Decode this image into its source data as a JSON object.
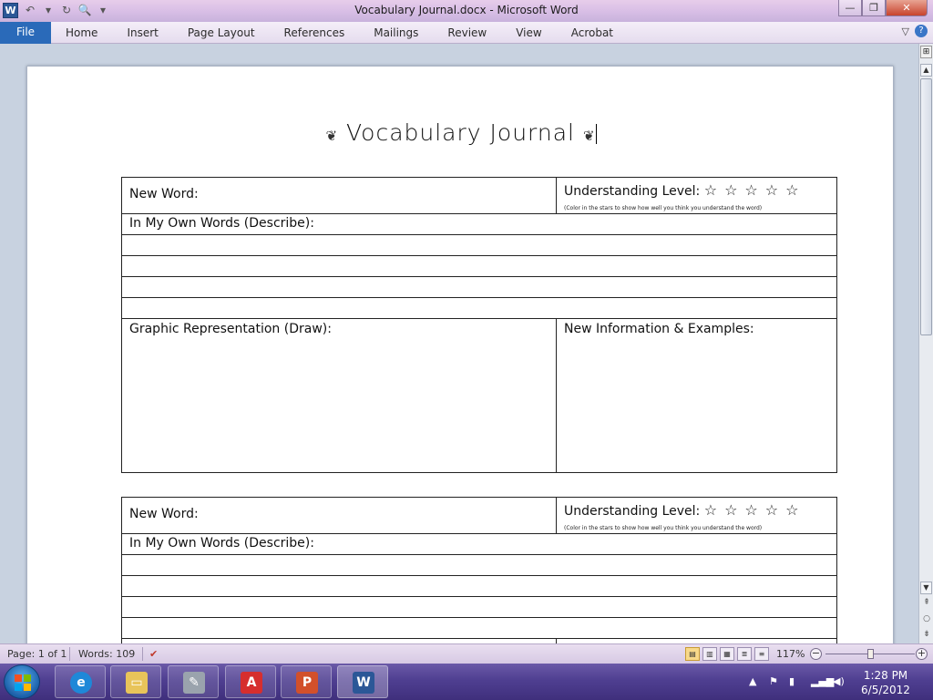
{
  "window": {
    "title": "Vocabulary Journal.docx - Microsoft Word",
    "app_icon": "W",
    "controls": {
      "minimize": "—",
      "restore": "❐",
      "close": "✕"
    }
  },
  "quick_access": {
    "undo": "↶",
    "undo_dd": "▾",
    "redo": "↻",
    "print_preview": "🔍",
    "customize": "▾"
  },
  "ribbon": {
    "file_label": "File",
    "tabs": [
      "Home",
      "Insert",
      "Page Layout",
      "References",
      "Mailings",
      "Review",
      "View",
      "Acrobat"
    ],
    "minimize_ribbon": "▽",
    "help": "?"
  },
  "document": {
    "title": "Vocabulary Journal",
    "bug_left": "❦",
    "bug_right": "❦",
    "block1": {
      "new_word_label": "New Word:",
      "understanding_label": "Understanding Level:",
      "stars": "☆☆☆☆☆",
      "understanding_note": "(Color in the stars to show how well you think you understand the word)",
      "own_words_label": "In My Own Words (Describe):",
      "graphic_label": "Graphic Representation (Draw):",
      "new_info_label": "New Information & Examples:"
    },
    "block2": {
      "new_word_label": "New Word:",
      "understanding_label": "Understanding Level:",
      "stars": "☆☆☆☆☆",
      "understanding_note": "(Color in the stars to show how well you think you understand the word)",
      "own_words_label": "In My Own Words (Describe):"
    }
  },
  "scrollbar": {
    "up": "▲",
    "down": "▼",
    "prev": "⇞",
    "browse": "○",
    "next": "⇟"
  },
  "status_bar": {
    "page": "Page: 1 of 1",
    "words": "Words: 109",
    "proofing_icon": "✔",
    "zoom": "117%",
    "zoom_out": "−",
    "zoom_in": "+",
    "zoom_fraction": 0.5
  },
  "taskbar": {
    "apps": [
      "internet-explorer",
      "windows-explorer",
      "paint-tools",
      "adobe-reader",
      "powerpoint",
      "word"
    ],
    "tray": {
      "show_hidden": "▲",
      "clock_time": "1:28 PM",
      "clock_date": "6/5/2012"
    }
  },
  "colors": {
    "file_tab": "#2a6ab9",
    "title_bar": "#d9bfe6",
    "taskbar": "#4f3f91"
  }
}
